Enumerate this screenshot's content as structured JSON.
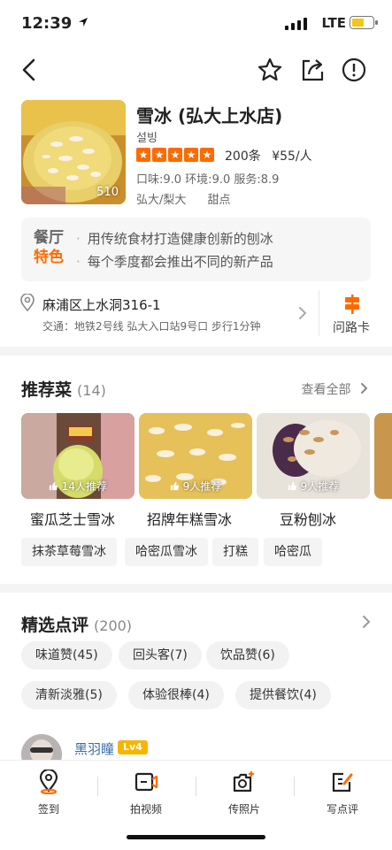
{
  "status": {
    "time": "12:39",
    "network": "LTE"
  },
  "restaurant": {
    "name": "雪冰 (弘大上水店)",
    "korean_name": "설빙",
    "photo_count": "510",
    "rating_stars": 5,
    "review_count": "200条",
    "price": "¥55/人",
    "scores": "口味:9.0 环境:9.0 服务:8.9",
    "categories": [
      "弘大/梨大",
      "甜点"
    ]
  },
  "features": {
    "badge_line1": "餐厅",
    "badge_line2": "特色",
    "items": [
      "用传统食材打造健康创新的刨冰",
      "每个季度都会推出不同的新产品"
    ]
  },
  "address": {
    "text": "麻浦区上水洞316-1",
    "transit": "交通：地铁2号线 弘大入口站9号口 步行1分钟",
    "route_card_label": "问路卡"
  },
  "recommended": {
    "title": "推荐菜",
    "count": "(14)",
    "see_all": "查看全部",
    "dishes": [
      {
        "name": "蜜瓜芝士雪冰",
        "recommend": "14人推荐"
      },
      {
        "name": "招牌年糕雪冰",
        "recommend": "9人推荐"
      },
      {
        "name": "豆粉刨冰",
        "recommend": "9人推荐"
      }
    ],
    "tags": [
      "抹茶草莓雪冰",
      "哈密瓜雪冰",
      "打糕",
      "哈密瓜"
    ]
  },
  "reviews": {
    "title": "精选点评",
    "count": "(200)",
    "tags": [
      "味道赞(45)",
      "回头客(7)",
      "饮品赞(6)",
      "清新淡雅(5)",
      "体验很棒(4)",
      "提供餐饮(4)"
    ],
    "first_reviewer": {
      "name": "黑羽瞳",
      "level": "Lv4"
    }
  },
  "bottom_bar": [
    "签到",
    "拍视频",
    "传照片",
    "写点评"
  ],
  "colors": {
    "accent": "#ff6a00",
    "level_badge": "#f7b500"
  },
  "icons": [
    "back-arrow-icon",
    "star-icon",
    "share-icon",
    "report-icon",
    "location-pin-icon",
    "chevron-right-icon",
    "signpost-icon",
    "thumb-up-icon",
    "checkin-pin-icon",
    "video-camera-icon",
    "camera-plus-icon",
    "edit-note-icon"
  ]
}
